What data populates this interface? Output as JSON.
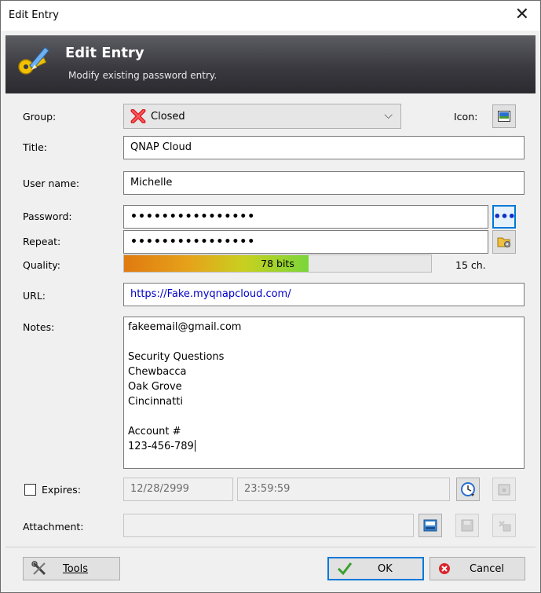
{
  "window": {
    "title": "Edit Entry"
  },
  "banner": {
    "title": "Edit Entry",
    "subtitle": "Modify existing password entry."
  },
  "group": {
    "label": "Group:",
    "value": "Closed"
  },
  "icon": {
    "label": "Icon:"
  },
  "title_field": {
    "label": "Title:",
    "value": "QNAP Cloud"
  },
  "username": {
    "label": "User name:",
    "value": "Michelle"
  },
  "password": {
    "label": "Password:",
    "value": "••••••••••••••••"
  },
  "repeat": {
    "label": "Repeat:",
    "value": "••••••••••••••••"
  },
  "quality": {
    "label": "Quality:",
    "bits_text": "78 bits",
    "fill_fraction": 0.6,
    "chars": "15 ch."
  },
  "url": {
    "label": "URL:",
    "value": "https://Fake.myqnapcloud.com/"
  },
  "notes": {
    "label": "Notes:",
    "lines": [
      "fakeemail@gmail.com",
      "",
      "Security Questions",
      "Chewbacca",
      "Oak Grove",
      "Cincinnatti",
      "",
      "Account #",
      "123-456-789"
    ]
  },
  "expires": {
    "label": "Expires:",
    "checked": false,
    "date": "12/28/2999",
    "time": "23:59:59"
  },
  "attachment": {
    "label": "Attachment:",
    "value": ""
  },
  "buttons": {
    "tools_label": "Tools",
    "ok_label": "OK",
    "cancel_label": "Cancel"
  },
  "colors": {
    "accent": "#0078d7",
    "link": "#0000c8",
    "banner_dark": "#2a2a2f"
  }
}
